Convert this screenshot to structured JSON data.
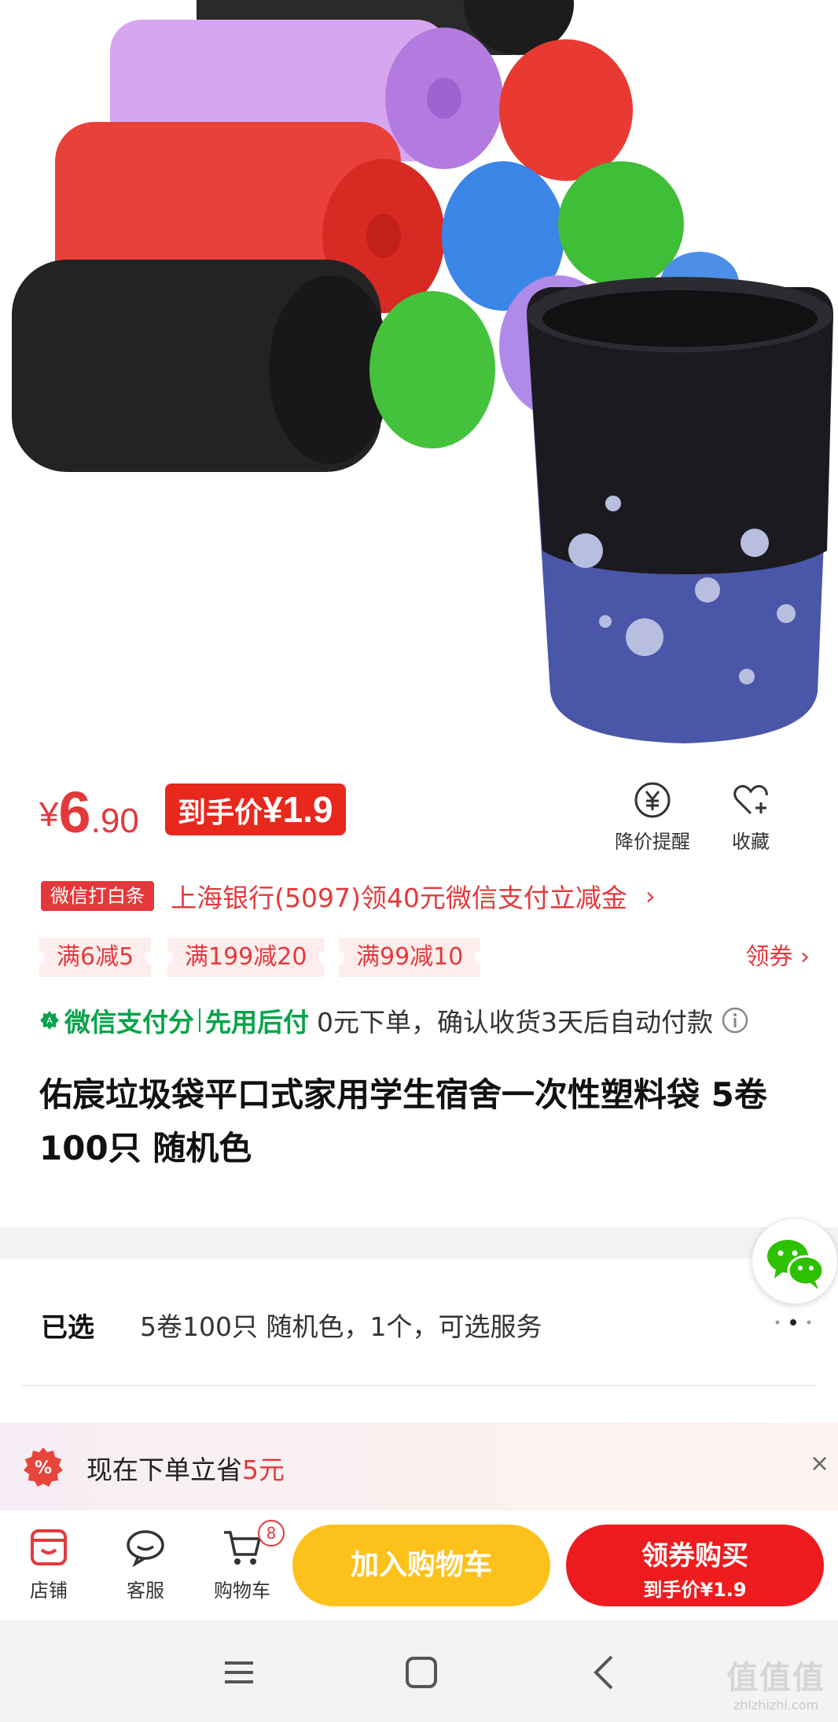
{
  "product_image": {
    "alt_icon": "trash-bag-rolls-image"
  },
  "price": {
    "currency": "¥",
    "integer": "6",
    "decimal": ".90",
    "final_label": "到手价",
    "final_value": "¥1.9"
  },
  "actions": {
    "remind_label": "降价提醒",
    "favorite_label": "收藏"
  },
  "bank_promo": {
    "tag": "微信打白条",
    "text": "上海银行(5097)领40元微信支付立减金",
    "arrow": "›"
  },
  "coupons": {
    "items": [
      "满6减5",
      "满199减20",
      "满99减10"
    ],
    "get_label": "领券 ›"
  },
  "pay_later": {
    "brand": "微信支付分",
    "mode": "先用后付",
    "desc": "0元下单，确认收货3天后自动付款"
  },
  "title": "佑宸垃圾袋平口式家用学生宿舍一次性塑料袋 5卷100只 随机色",
  "selection": {
    "label": "已选",
    "value": "5卷100只 随机色，1个，可选服务"
  },
  "save_banner": {
    "prefix": "现在下单立省",
    "amount": "5元",
    "close": "×"
  },
  "bottom_bar": {
    "shop_label": "店铺",
    "service_label": "客服",
    "cart_label": "购物车",
    "cart_count": "8",
    "add_to_cart": "加入购物车",
    "buy_line1": "领券购买",
    "buy_line2": "到手价¥1.9"
  },
  "watermark": {
    "logo": "值值值",
    "url": "zhizhizhi.com"
  },
  "colors": {
    "price_red": "#e4393c",
    "wechat_green": "#07a34a",
    "cart_yellow": "#fcc21b",
    "buy_red": "#ee1c1f"
  }
}
